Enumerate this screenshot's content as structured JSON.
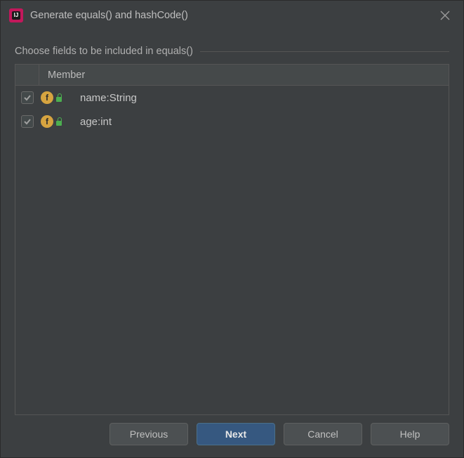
{
  "titlebar": {
    "title": "Generate equals() and hashCode()"
  },
  "group": {
    "label": "Choose fields to be included in equals()"
  },
  "table": {
    "header": {
      "member": "Member"
    },
    "rows": [
      {
        "checked": true,
        "icon": "f",
        "text": "name:String"
      },
      {
        "checked": true,
        "icon": "f",
        "text": "age:int"
      }
    ]
  },
  "buttons": {
    "previous": "Previous",
    "next": "Next",
    "cancel": "Cancel",
    "help": "Help"
  }
}
